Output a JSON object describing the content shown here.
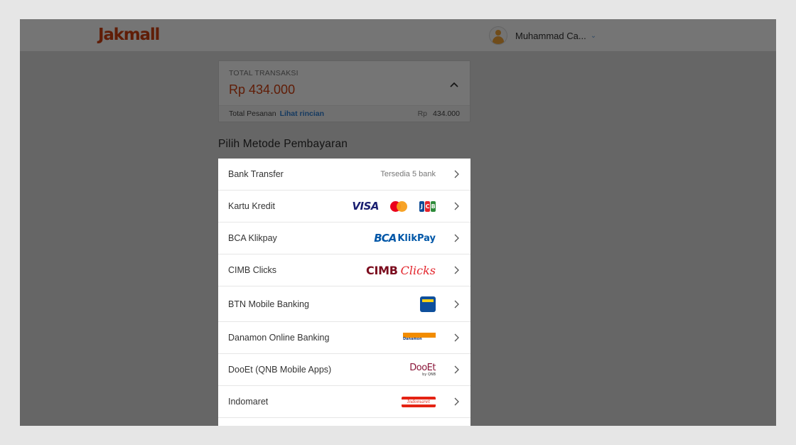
{
  "colors": {
    "brand": "#d14010",
    "price": "#d14010",
    "link": "#2f7fd1",
    "visa": "#1a1f71",
    "bca": "#0057a8",
    "cimb": "#7b0c1e",
    "clicks": "#e3242b",
    "btn_bg": "#0e4f9c",
    "btn_stripe": "#f7d117",
    "danamon_orange": "#f28c00",
    "dooet": "#8a1538",
    "indomaret_red": "#e42313",
    "indomaret_blue": "#1b4b9b"
  },
  "header": {
    "logo": "Jakmall",
    "user_name": "Muhammad Ca...",
    "user_avatar_icon": "avatar-icon",
    "dropdown_icon": "chevron-down-icon"
  },
  "summary": {
    "label": "TOTAL TRANSAKSI",
    "amount": "Rp 434.000",
    "toggle_icon": "chevron-up-icon",
    "footer_label": "Total Pesanan",
    "footer_link": "Lihat rincian",
    "footer_currency": "Rp",
    "footer_value": "434.000"
  },
  "payment": {
    "title": "Pilih Metode Pembayaran",
    "methods": [
      {
        "label": "Bank Transfer",
        "availability": "Tersedia 5 bank"
      },
      {
        "label": "Kartu Kredit",
        "logos": {
          "visa": "VISA",
          "jcb": [
            "J",
            "C",
            "B"
          ]
        }
      },
      {
        "label": "BCA Klikpay",
        "logo_bca": "BCA",
        "logo_klikpay": "KlikPay"
      },
      {
        "label": "CIMB Clicks",
        "logo_cimb": "CIMB",
        "logo_clicks": "Clicks"
      },
      {
        "label": "BTN Mobile Banking"
      },
      {
        "label": "Danamon Online Banking",
        "logo_text": "Danamon"
      },
      {
        "label": "DooEt (QNB Mobile Apps)",
        "logo_main": "DooEt",
        "logo_sub": "by QNB"
      },
      {
        "label": "Indomaret",
        "logo_text": "Indomaret"
      }
    ]
  }
}
